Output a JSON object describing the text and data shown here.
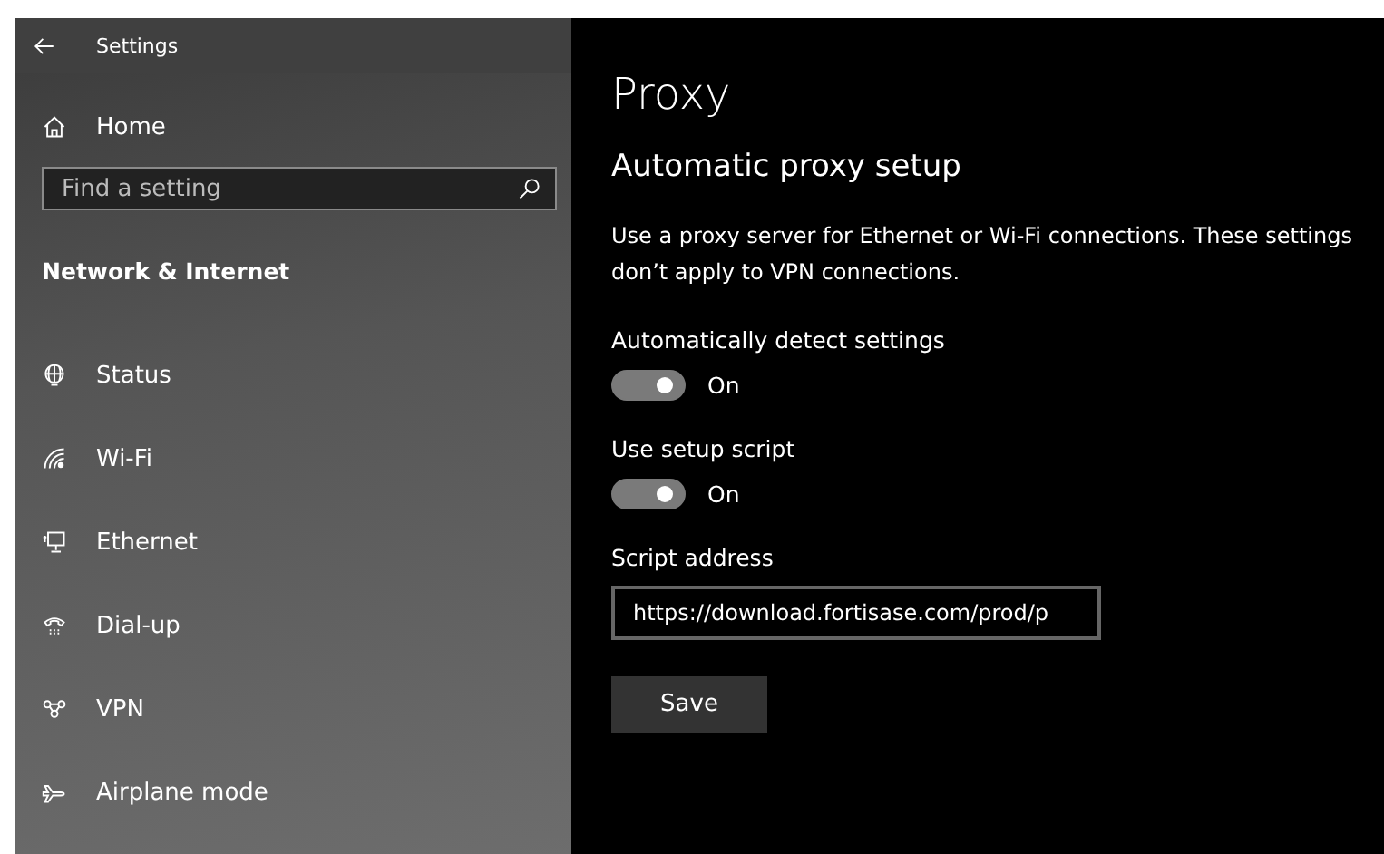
{
  "window": {
    "title": "Settings"
  },
  "sidebar": {
    "home": "Home",
    "search": {
      "placeholder": "Find a setting"
    },
    "section": "Network & Internet",
    "items": [
      {
        "label": "Status",
        "selected": false
      },
      {
        "label": "Wi-Fi",
        "selected": false
      },
      {
        "label": "Ethernet",
        "selected": false
      },
      {
        "label": "Dial-up",
        "selected": false
      },
      {
        "label": "VPN",
        "selected": false
      },
      {
        "label": "Airplane mode",
        "selected": false
      }
    ]
  },
  "main": {
    "title": "Proxy",
    "subtitle": "Automatic proxy setup",
    "description": "Use a proxy server for Ethernet or Wi-Fi connections. These settings don’t apply to VPN connections.",
    "settings": [
      {
        "kind": "toggle",
        "label": "Automatically detect settings",
        "on": true,
        "state_text": "On"
      },
      {
        "kind": "toggle",
        "label": "Use setup script",
        "on": true,
        "state_text": "On"
      },
      {
        "kind": "field",
        "label": "Script address",
        "value": "https://download.fortisase.com/prod/p"
      }
    ],
    "save_button": "Save"
  }
}
